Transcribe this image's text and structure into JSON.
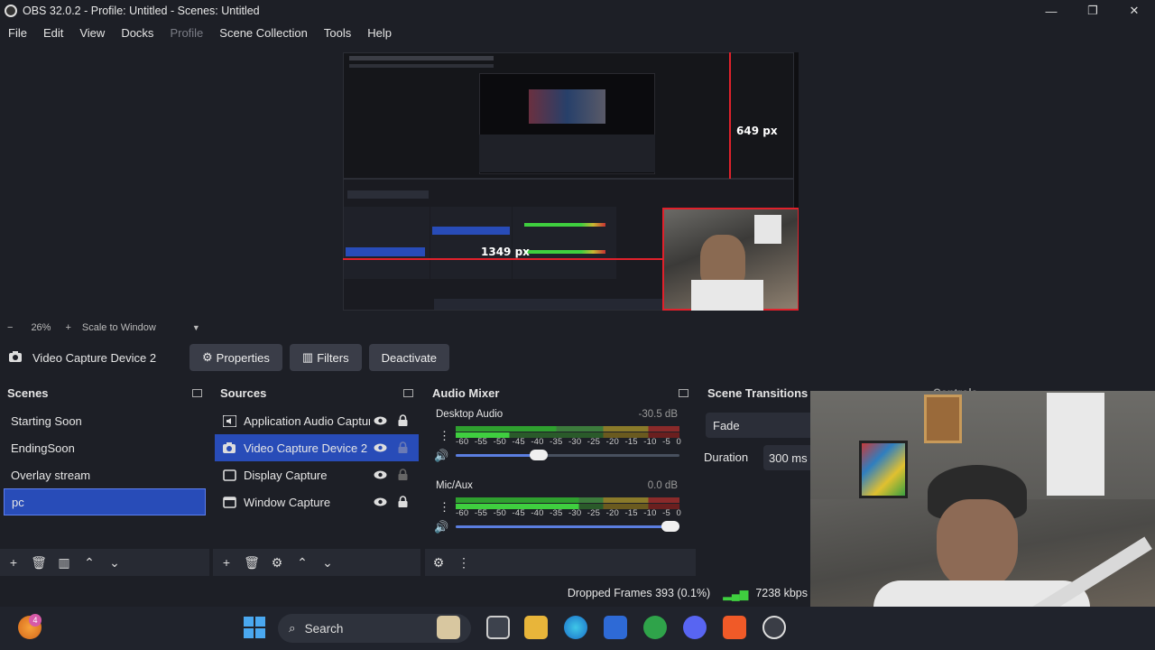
{
  "window": {
    "title": "OBS 32.0.2 - Profile: Untitled - Scenes: Untitled",
    "minimize": "—",
    "maximize": "❐",
    "close": "✕"
  },
  "menu": [
    "File",
    "Edit",
    "View",
    "Docks",
    "Profile",
    "Scene Collection",
    "Tools",
    "Help"
  ],
  "preview": {
    "height_label": "649 px",
    "width_label": "1349 px"
  },
  "zoom": {
    "minus": "−",
    "level": "26%",
    "plus": "+",
    "mode": "Scale to Window"
  },
  "source_toolbar": {
    "source_name": "Video Capture Device 2",
    "properties": "Properties",
    "filters": "Filters",
    "deactivate": "Deactivate"
  },
  "scenes": {
    "title": "Scenes",
    "items": [
      "Starting Soon",
      "EndingSoon",
      "Overlay stream",
      "pc"
    ],
    "selected": "pc"
  },
  "sources": {
    "title": "Sources",
    "items": [
      {
        "label": "Application Audio Capture",
        "icon": "speaker-icon",
        "selected": false
      },
      {
        "label": "Video Capture Device 2",
        "icon": "camera-icon",
        "selected": true
      },
      {
        "label": "Display Capture",
        "icon": "monitor-icon",
        "selected": false
      },
      {
        "label": "Window Capture",
        "icon": "window-icon",
        "selected": false
      }
    ]
  },
  "mixer": {
    "title": "Audio Mixer",
    "scale": [
      "-60",
      "-55",
      "-50",
      "-45",
      "-40",
      "-35",
      "-30",
      "-25",
      "-20",
      "-15",
      "-10",
      "-5",
      "0"
    ],
    "tracks": [
      {
        "name": "Desktop Audio",
        "db": "-30.5 dB",
        "volume": 0.37
      },
      {
        "name": "Mic/Aux",
        "db": "0.0 dB",
        "volume": 1.0
      }
    ]
  },
  "transitions": {
    "title": "Scene Transitions",
    "selected": "Fade",
    "duration_label": "Duration",
    "duration_value": "300 ms"
  },
  "controls": {
    "title": "Controls"
  },
  "status": {
    "dropped": "Dropped Frames 393 (0.1%)",
    "bitrate": "7238 kbps"
  },
  "taskbar": {
    "search": "Search",
    "badge_count": "4"
  },
  "colors": {
    "selection": "#284cb8",
    "meter_green": "#3fcf3f",
    "meter_yellow": "#c8b832",
    "meter_red": "#c83232",
    "accent_red": "#e0212b"
  }
}
